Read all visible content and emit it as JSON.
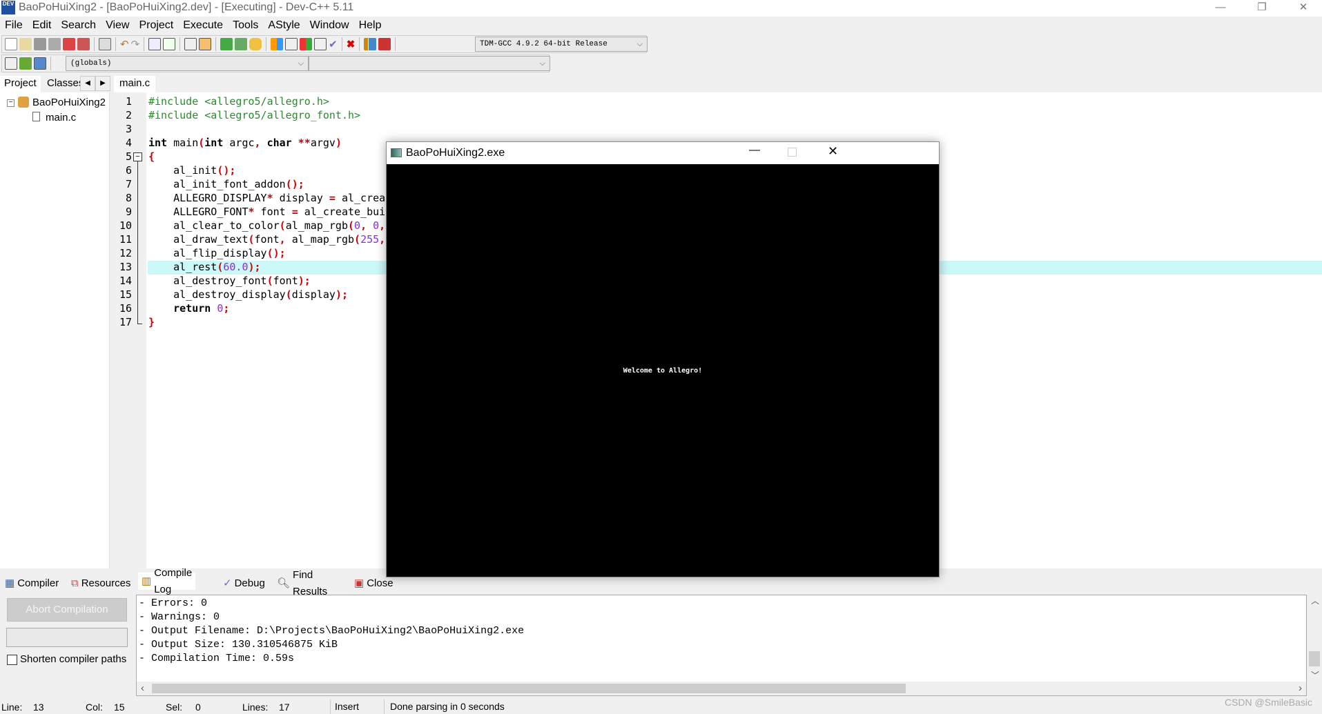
{
  "window": {
    "title": "BaoPoHuiXing2 - [BaoPoHuiXing2.dev] - [Executing] - Dev-C++ 5.11",
    "icon_text": "DEV"
  },
  "menu": [
    "File",
    "Edit",
    "Search",
    "View",
    "Project",
    "Execute",
    "Tools",
    "AStyle",
    "Window",
    "Help"
  ],
  "toolbar": {
    "compiler_select": "TDM-GCC 4.9.2 64-bit Release",
    "scope_select": "(globals)",
    "function_select": ""
  },
  "left_tabs": [
    "Project",
    "Classes"
  ],
  "project_tree": {
    "root": "BaoPoHuiXing2",
    "files": [
      "main.c"
    ]
  },
  "editor": {
    "tab": "main.c",
    "highlighted_line": 13,
    "lines": [
      [
        {
          "t": "#include <allegro5/allegro.h>",
          "c": "pp"
        }
      ],
      [
        {
          "t": "#include <allegro5/allegro_font.h>",
          "c": "pp"
        }
      ],
      [],
      [
        {
          "t": "int",
          "c": "kw"
        },
        {
          "t": " main"
        },
        {
          "t": "(",
          "c": "sy"
        },
        {
          "t": "int",
          "c": "kw"
        },
        {
          "t": " argc"
        },
        {
          "t": ",",
          "c": "sy"
        },
        {
          "t": " "
        },
        {
          "t": "char",
          "c": "kw"
        },
        {
          "t": " "
        },
        {
          "t": "**",
          "c": "sy"
        },
        {
          "t": "argv"
        },
        {
          "t": ")",
          "c": "sy"
        }
      ],
      [
        {
          "t": "{",
          "c": "sy"
        }
      ],
      [
        {
          "t": "    al_init"
        },
        {
          "t": "();",
          "c": "sy"
        }
      ],
      [
        {
          "t": "    al_init_font_addon"
        },
        {
          "t": "();",
          "c": "sy"
        }
      ],
      [
        {
          "t": "    ALLEGRO_DISPLAY"
        },
        {
          "t": "*",
          "c": "sy"
        },
        {
          "t": " display "
        },
        {
          "t": "=",
          "c": "sy"
        },
        {
          "t": " al_crea"
        }
      ],
      [
        {
          "t": "    ALLEGRO_FONT"
        },
        {
          "t": "*",
          "c": "sy"
        },
        {
          "t": " font "
        },
        {
          "t": "=",
          "c": "sy"
        },
        {
          "t": " al_create_bui"
        }
      ],
      [
        {
          "t": "    al_clear_to_color"
        },
        {
          "t": "(",
          "c": "sy"
        },
        {
          "t": "al_map_rgb"
        },
        {
          "t": "(",
          "c": "sy"
        },
        {
          "t": "0",
          "c": "nm"
        },
        {
          "t": ",",
          "c": "sy"
        },
        {
          "t": " "
        },
        {
          "t": "0",
          "c": "nm"
        },
        {
          "t": ",",
          "c": "sy"
        }
      ],
      [
        {
          "t": "    al_draw_text"
        },
        {
          "t": "(",
          "c": "sy"
        },
        {
          "t": "font"
        },
        {
          "t": ",",
          "c": "sy"
        },
        {
          "t": " al_map_rgb"
        },
        {
          "t": "(",
          "c": "sy"
        },
        {
          "t": "255",
          "c": "nm"
        },
        {
          "t": ",",
          "c": "sy"
        }
      ],
      [
        {
          "t": "    al_flip_display"
        },
        {
          "t": "();",
          "c": "sy"
        }
      ],
      [
        {
          "t": "    al_rest"
        },
        {
          "t": "(",
          "c": "sy"
        },
        {
          "t": "60.0",
          "c": "nm"
        },
        {
          "t": ");",
          "c": "sy"
        }
      ],
      [
        {
          "t": "    al_destroy_font"
        },
        {
          "t": "(",
          "c": "sy"
        },
        {
          "t": "font"
        },
        {
          "t": ");",
          "c": "sy"
        }
      ],
      [
        {
          "t": "    al_destroy_display"
        },
        {
          "t": "(",
          "c": "sy"
        },
        {
          "t": "display"
        },
        {
          "t": ");",
          "c": "sy"
        }
      ],
      [
        {
          "t": "    "
        },
        {
          "t": "return",
          "c": "kw"
        },
        {
          "t": " "
        },
        {
          "t": "0",
          "c": "nm"
        },
        {
          "t": ";",
          "c": "sy"
        }
      ],
      [
        {
          "t": "}",
          "c": "sy"
        }
      ]
    ]
  },
  "exe_window": {
    "title": "BaoPoHuiXing2.exe",
    "canvas_text": "Welcome to Allegro!"
  },
  "bottom_tabs": [
    "Compiler",
    "Resources",
    "Compile Log",
    "Debug",
    "Find Results",
    "Close"
  ],
  "bottom_active_tab": "Compile Log",
  "compile_panel": {
    "abort_label": "Abort Compilation",
    "shorten_label": "Shorten compiler paths",
    "shorten_checked": false
  },
  "log": [
    "- Errors: 0",
    "- Warnings: 0",
    "- Output Filename: D:\\Projects\\BaoPoHuiXing2\\BaoPoHuiXing2.exe",
    "- Output Size: 130.310546875 KiB",
    "- Compilation Time: 0.59s"
  ],
  "status": {
    "line_label": "Line:",
    "line": "13",
    "col_label": "Col:",
    "col": "15",
    "sel_label": "Sel:",
    "sel": "0",
    "lines_label": "Lines:",
    "lines": "17",
    "mode": "Insert",
    "message": "Done parsing in 0 seconds"
  },
  "watermark": "CSDN @SmileBasic"
}
